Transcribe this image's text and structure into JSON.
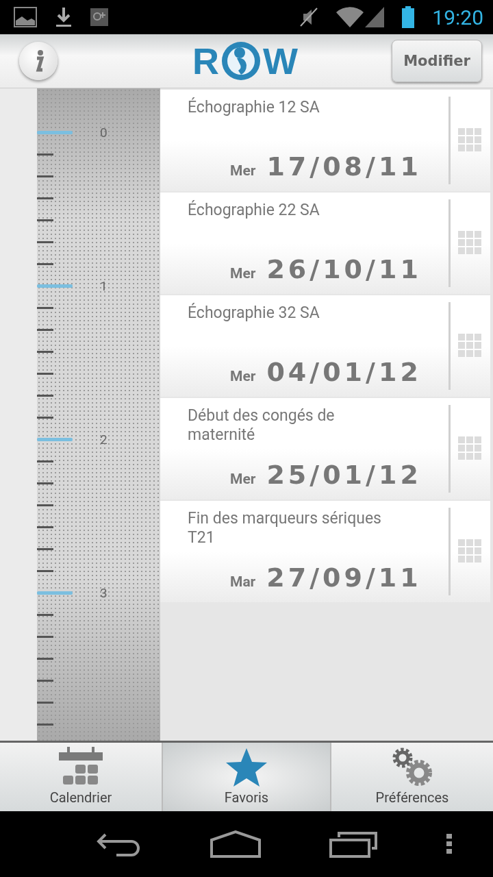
{
  "status_bar": {
    "time": "19:20"
  },
  "header": {
    "logo": {
      "left": "R",
      "right": "W"
    },
    "edit_button": "Modifier"
  },
  "ruler": {
    "labels": [
      "0",
      "1",
      "2",
      "3"
    ]
  },
  "events": [
    {
      "title": "Échographie 12 SA",
      "day": "Mer",
      "date": "17/08/11"
    },
    {
      "title": "Échographie 22 SA",
      "day": "Mer",
      "date": "26/10/11"
    },
    {
      "title": "Échographie 32 SA",
      "day": "Mer",
      "date": "04/01/12"
    },
    {
      "title": "Début des congés de maternité",
      "day": "Mer",
      "date": "25/01/12"
    },
    {
      "title": "Fin des marqueurs sériques T21",
      "day": "Mar",
      "date": "27/09/11"
    }
  ],
  "tabs": [
    {
      "label": "Calendrier",
      "kind": "calendar",
      "selected": false
    },
    {
      "label": "Favoris",
      "kind": "star",
      "selected": true
    },
    {
      "label": "Préférences",
      "kind": "gears",
      "selected": false
    }
  ]
}
